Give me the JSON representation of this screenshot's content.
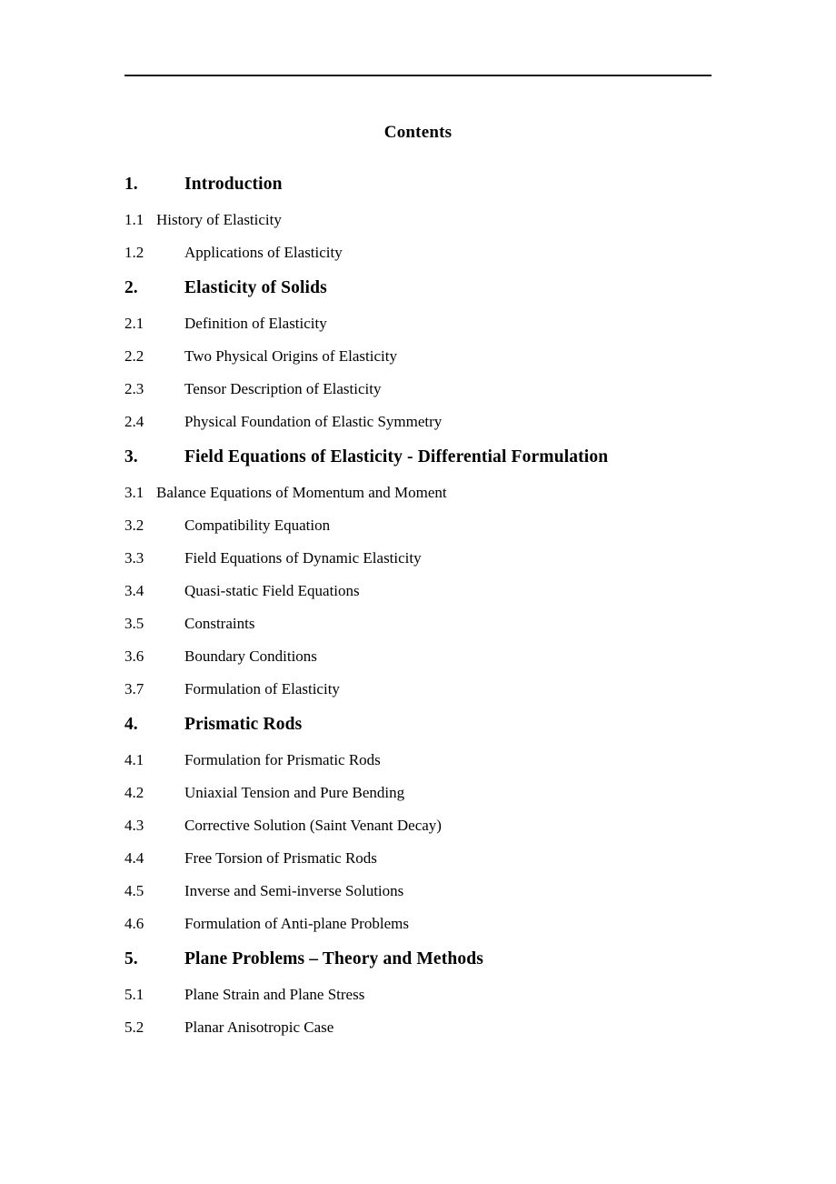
{
  "document": {
    "title": "Contents",
    "rule": {
      "color": "#1a1a1a"
    }
  },
  "toc": {
    "entries": [
      {
        "num": "1.",
        "title": "Introduction",
        "level": 1,
        "indent": "wide"
      },
      {
        "num": "1.1",
        "title": "History of Elasticity",
        "level": 2,
        "indent": "narrow"
      },
      {
        "num": "1.2",
        "title": "Applications of Elasticity",
        "level": 2,
        "indent": "wide"
      },
      {
        "num": "2.",
        "title": "Elasticity of Solids",
        "level": 1,
        "indent": "wide"
      },
      {
        "num": "2.1",
        "title": "Definition of Elasticity",
        "level": 2,
        "indent": "wide"
      },
      {
        "num": "2.2",
        "title": "Two Physical Origins of Elasticity",
        "level": 2,
        "indent": "wide"
      },
      {
        "num": "2.3",
        "title": "Tensor Description of Elasticity",
        "level": 2,
        "indent": "wide"
      },
      {
        "num": "2.4",
        "title": "Physical Foundation of Elastic Symmetry",
        "level": 2,
        "indent": "wide"
      },
      {
        "num": "3.",
        "title": "Field Equations of Elasticity - Differential Formulation",
        "level": 1,
        "indent": "wide"
      },
      {
        "num": "3.1",
        "title": "Balance Equations of Momentum and Moment",
        "level": 2,
        "indent": "narrow"
      },
      {
        "num": "3.2",
        "title": "Compatibility Equation",
        "level": 2,
        "indent": "wide"
      },
      {
        "num": "3.3",
        "title": "Field Equations of Dynamic Elasticity",
        "level": 2,
        "indent": "wide"
      },
      {
        "num": "3.4",
        "title": "Quasi-static Field Equations",
        "level": 2,
        "indent": "wide"
      },
      {
        "num": "3.5",
        "title": "Constraints",
        "level": 2,
        "indent": "wide"
      },
      {
        "num": "3.6",
        "title": "Boundary Conditions",
        "level": 2,
        "indent": "wide"
      },
      {
        "num": "3.7",
        "title": "Formulation of Elasticity",
        "level": 2,
        "indent": "wide"
      },
      {
        "num": "4.",
        "title": "Prismatic Rods",
        "level": 1,
        "indent": "wide"
      },
      {
        "num": "4.1",
        "title": "Formulation for Prismatic Rods",
        "level": 2,
        "indent": "wide"
      },
      {
        "num": "4.2",
        "title": "Uniaxial Tension and Pure Bending",
        "level": 2,
        "indent": "wide"
      },
      {
        "num": "4.3",
        "title": "Corrective Solution (Saint Venant Decay)",
        "level": 2,
        "indent": "wide"
      },
      {
        "num": "4.4",
        "title": "Free Torsion of Prismatic Rods",
        "level": 2,
        "indent": "wide"
      },
      {
        "num": "4.5",
        "title": "Inverse and Semi-inverse Solutions",
        "level": 2,
        "indent": "wide"
      },
      {
        "num": "4.6",
        "title": "Formulation of Anti-plane Problems",
        "level": 2,
        "indent": "wide"
      },
      {
        "num": "5.",
        "title": "Plane Problems – Theory and Methods",
        "level": 1,
        "indent": "wide"
      },
      {
        "num": "5.1",
        "title": "Plane Strain and Plane Stress",
        "level": 2,
        "indent": "wide"
      },
      {
        "num": "5.2",
        "title": "Planar Anisotropic Case",
        "level": 2,
        "indent": "wide"
      }
    ]
  }
}
